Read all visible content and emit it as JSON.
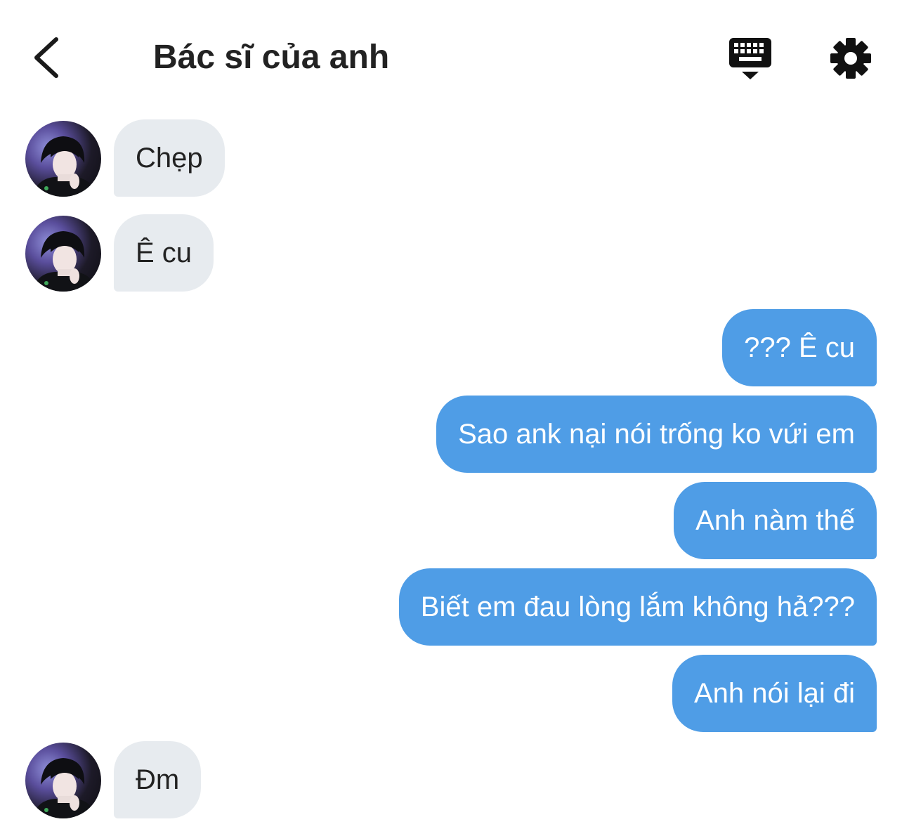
{
  "header": {
    "title": "Bác sĩ của anh",
    "back_icon": "chevron-left-icon",
    "keyboard_icon": "keyboard-icon",
    "settings_icon": "gear-icon"
  },
  "colors": {
    "outgoing_bubble": "#4f9de6",
    "incoming_bubble": "#e7ebef",
    "text_dark": "#222222"
  },
  "messages": [
    {
      "direction": "incoming",
      "text": "Chẹp"
    },
    {
      "direction": "incoming",
      "text": "Ê cu"
    },
    {
      "direction": "outgoing",
      "text": "??? Ê cu"
    },
    {
      "direction": "outgoing",
      "text": "Sao ank nại nói trống ko vứi em"
    },
    {
      "direction": "outgoing",
      "text": "Anh nàm thế "
    },
    {
      "direction": "outgoing",
      "text": "Biết em đau lòng lắm không hả???"
    },
    {
      "direction": "outgoing",
      "text": "Anh nói lại đi"
    },
    {
      "direction": "incoming",
      "text": "Đm"
    }
  ]
}
